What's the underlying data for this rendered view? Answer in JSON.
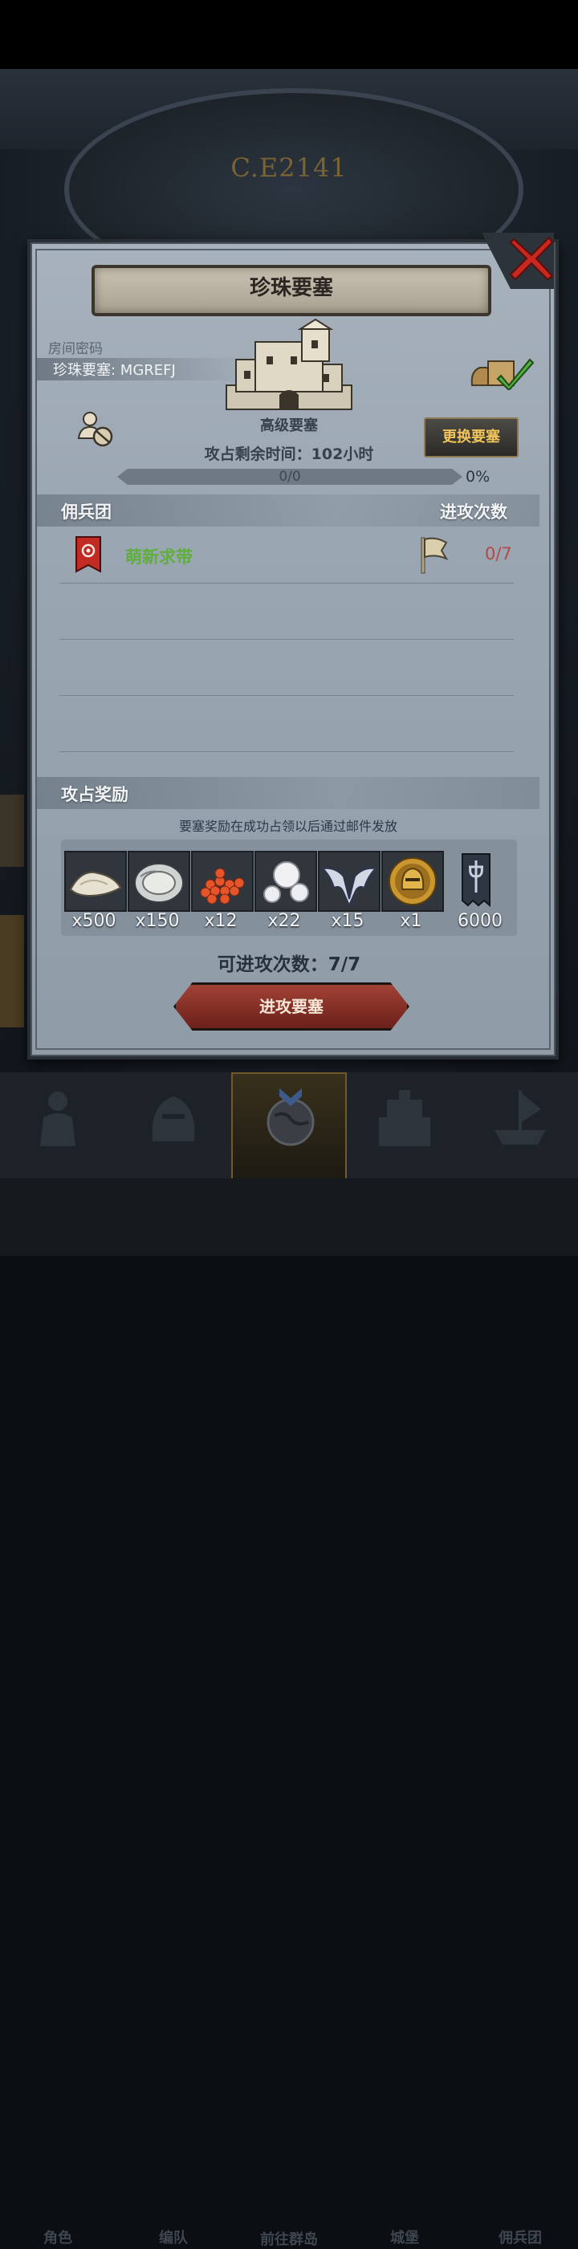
{
  "background": {
    "year_label": "C.E2141"
  },
  "dialog": {
    "title": "珍珠要塞",
    "room_label": "房间密码",
    "room_code": "珍珠要塞: MGREFJ",
    "fortress_grade": "高级要塞",
    "time_remaining": "攻占剩余时间：102小时",
    "change_button": "更换要塞",
    "progress": {
      "text": "0/0",
      "percent_text": "0%",
      "percent": 0
    },
    "mercenary_header": "佣兵团",
    "attempts_header": "进攻次数",
    "guilds": [
      {
        "name": "萌新求带",
        "attempts": "0/7"
      }
    ],
    "rewards_header": "攻占奖励",
    "reward_note": "要塞奖励在成功占领以后通过邮件发放",
    "rewards": [
      {
        "icon": "flour-pile-icon",
        "qty": "x500"
      },
      {
        "icon": "oyster-icon",
        "qty": "x150"
      },
      {
        "icon": "caviar-icon",
        "qty": "x12"
      },
      {
        "icon": "pearls-icon",
        "qty": "x22"
      },
      {
        "icon": "silver-wings-icon",
        "qty": "x15"
      },
      {
        "icon": "gold-helmet-coin-icon",
        "qty": "x1"
      },
      {
        "icon": "guild-banner-icon",
        "qty": "6000"
      }
    ],
    "attack_count": "可进攻次数：7/7",
    "attack_button": "进攻要塞"
  },
  "nav": {
    "items": [
      {
        "label": "角色",
        "icon": "knight-icon",
        "active": false
      },
      {
        "label": "编队",
        "icon": "helmet-icon",
        "active": false
      },
      {
        "label": "前往群岛",
        "icon": "globe-icon",
        "active": true
      },
      {
        "label": "城堡",
        "icon": "castle-icon",
        "active": false
      },
      {
        "label": "佣兵团",
        "icon": "ship-icon",
        "active": false
      }
    ]
  },
  "colors": {
    "accent_gold": "#f0c45a",
    "green_name": "#5fae3e",
    "red_attempts": "#b34a44",
    "attack_red": "#8a2e25"
  }
}
